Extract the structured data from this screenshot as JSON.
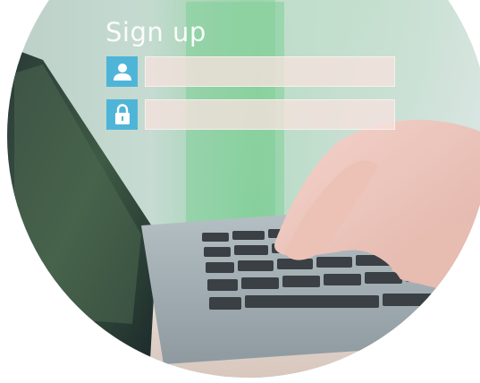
{
  "signup": {
    "title": "Sign up",
    "username_field": {
      "icon": "user-icon",
      "value": "",
      "placeholder": ""
    },
    "password_field": {
      "icon": "lock-icon",
      "value": "",
      "placeholder": ""
    }
  },
  "colors": {
    "icon_background": "#4fb5d8",
    "input_background": "#f6e2de"
  }
}
